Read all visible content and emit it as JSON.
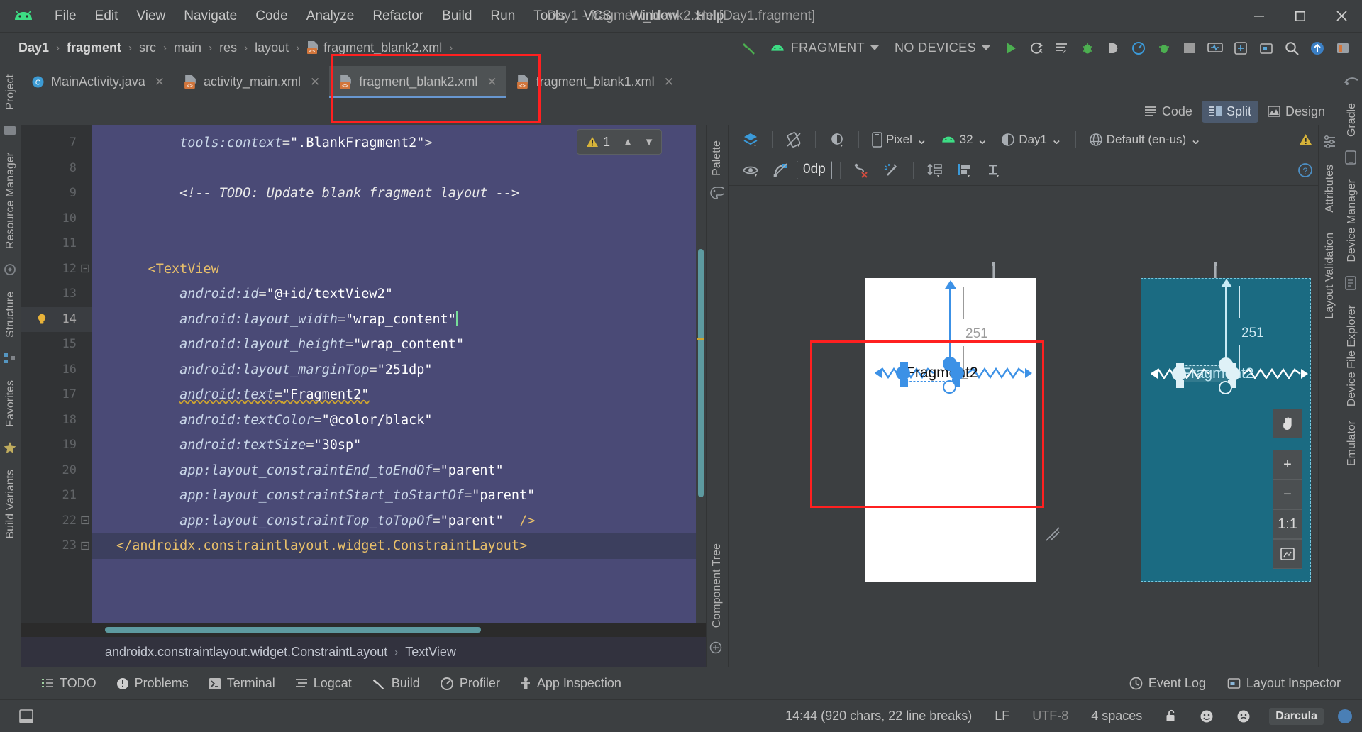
{
  "window": {
    "title": "Day1 - fragment_blank2.xml [Day1.fragment]",
    "minimize": "–",
    "maximize": "▢",
    "close": "✕"
  },
  "menubar": {
    "items": [
      {
        "label": "File",
        "mn": "F"
      },
      {
        "label": "Edit",
        "mn": "E"
      },
      {
        "label": "View",
        "mn": "V"
      },
      {
        "label": "Navigate",
        "mn": "N"
      },
      {
        "label": "Code",
        "mn": "C"
      },
      {
        "label": "Analyze",
        "mn": "z"
      },
      {
        "label": "Refactor",
        "mn": "R"
      },
      {
        "label": "Build",
        "mn": "B"
      },
      {
        "label": "Run",
        "mn": "u"
      },
      {
        "label": "Tools",
        "mn": "T"
      },
      {
        "label": "VCS",
        "mn": "S"
      },
      {
        "label": "Window",
        "mn": "W"
      },
      {
        "label": "Help",
        "mn": "H"
      }
    ]
  },
  "navbar": {
    "breadcrumbs": [
      "Day1",
      "fragment",
      "src",
      "main",
      "res",
      "layout",
      "fragment_blank2.xml"
    ],
    "separator": "›",
    "run_config": "FRAGMENT",
    "device": "NO DEVICES",
    "icons": [
      "build-hammer-icon",
      "android-icon",
      "run-icon",
      "run-with-coverage-icon",
      "apply-changes-icon",
      "debug-icon",
      "profile-icon",
      "attach-debugger-icon",
      "stop-icon",
      "avd-manager-icon",
      "sdk-manager-icon",
      "layout-inspector-icon",
      "search-icon",
      "update-icon",
      "project-structure-icon"
    ]
  },
  "left_strip": {
    "tabs": [
      "Project",
      "Resource Manager",
      "Structure",
      "Favorites",
      "Build Variants"
    ]
  },
  "right_strip": {
    "tabs": [
      "Gradle",
      "Device Manager",
      "Device File Explorer",
      "Emulator"
    ]
  },
  "editor_tabs": [
    {
      "label": "MainActivity.java",
      "icon": "java-class-icon",
      "active": false,
      "close": "✕"
    },
    {
      "label": "activity_main.xml",
      "icon": "xml-layout-icon",
      "active": false,
      "close": "✕"
    },
    {
      "label": "fragment_blank2.xml",
      "icon": "xml-layout-icon",
      "active": true,
      "close": "✕"
    },
    {
      "label": "fragment_blank1.xml",
      "icon": "xml-layout-icon",
      "active": false,
      "close": "✕"
    }
  ],
  "view_modes": [
    {
      "label": "Code",
      "icon": "code-lines-icon",
      "selected": false
    },
    {
      "label": "Split",
      "icon": "split-view-icon",
      "selected": true
    },
    {
      "label": "Design",
      "icon": "design-view-icon",
      "selected": false
    }
  ],
  "editor": {
    "first_line": 7,
    "current_line": 14,
    "lines": [
      {
        "n": 7,
        "segments": [
          {
            "t": "        ",
            "c": "punct"
          },
          {
            "t": "tools:context",
            "c": "attr"
          },
          {
            "t": "=",
            "c": "punct"
          },
          {
            "t": "\".BlankFragment2\"",
            "c": "str"
          },
          {
            "t": ">",
            "c": "punct"
          }
        ]
      },
      {
        "n": 8,
        "segments": []
      },
      {
        "n": 9,
        "segments": [
          {
            "t": "        ",
            "c": "punct"
          },
          {
            "t": "<!-- TODO: Update blank fragment layout -->",
            "c": "cmt"
          }
        ]
      },
      {
        "n": 10,
        "segments": []
      },
      {
        "n": 11,
        "segments": []
      },
      {
        "n": 12,
        "segments": [
          {
            "t": "    ",
            "c": "punct"
          },
          {
            "t": "<TextView",
            "c": "tag"
          }
        ]
      },
      {
        "n": 13,
        "segments": [
          {
            "t": "        ",
            "c": "punct"
          },
          {
            "t": "android:id",
            "c": "attr"
          },
          {
            "t": "=",
            "c": "punct"
          },
          {
            "t": "\"@+id/textView2\"",
            "c": "str"
          }
        ]
      },
      {
        "n": 14,
        "segments": [
          {
            "t": "        ",
            "c": "punct"
          },
          {
            "t": "android:layout_width",
            "c": "attr"
          },
          {
            "t": "=",
            "c": "punct"
          },
          {
            "t": "\"wrap_content\"",
            "c": "str"
          }
        ]
      },
      {
        "n": 15,
        "segments": [
          {
            "t": "        ",
            "c": "punct"
          },
          {
            "t": "android:layout_height",
            "c": "attr"
          },
          {
            "t": "=",
            "c": "punct"
          },
          {
            "t": "\"wrap_content\"",
            "c": "str"
          }
        ]
      },
      {
        "n": 16,
        "segments": [
          {
            "t": "        ",
            "c": "punct"
          },
          {
            "t": "android:layout_marginTop",
            "c": "attr"
          },
          {
            "t": "=",
            "c": "punct"
          },
          {
            "t": "\"251dp\"",
            "c": "str"
          }
        ]
      },
      {
        "n": 17,
        "segments": [
          {
            "t": "        ",
            "c": "punct"
          },
          {
            "t": "android:text",
            "c": "attr squig"
          },
          {
            "t": "=",
            "c": "punct squig"
          },
          {
            "t": "\"Fragment2\"",
            "c": "str squig"
          }
        ]
      },
      {
        "n": 18,
        "segments": [
          {
            "t": "        ",
            "c": "punct"
          },
          {
            "t": "android:textColor",
            "c": "attr"
          },
          {
            "t": "=",
            "c": "punct"
          },
          {
            "t": "\"@color/black\"",
            "c": "str"
          }
        ]
      },
      {
        "n": 19,
        "segments": [
          {
            "t": "        ",
            "c": "punct"
          },
          {
            "t": "android:textSize",
            "c": "attr"
          },
          {
            "t": "=",
            "c": "punct"
          },
          {
            "t": "\"30sp\"",
            "c": "str"
          }
        ]
      },
      {
        "n": 20,
        "segments": [
          {
            "t": "        ",
            "c": "punct"
          },
          {
            "t": "app:layout_constraintEnd_toEndOf",
            "c": "attr"
          },
          {
            "t": "=",
            "c": "punct"
          },
          {
            "t": "\"parent\"",
            "c": "str"
          }
        ]
      },
      {
        "n": 21,
        "segments": [
          {
            "t": "        ",
            "c": "punct"
          },
          {
            "t": "app:layout_constraintStart_toStartOf",
            "c": "attr"
          },
          {
            "t": "=",
            "c": "punct"
          },
          {
            "t": "\"parent\"",
            "c": "str"
          }
        ]
      },
      {
        "n": 22,
        "segments": [
          {
            "t": "        ",
            "c": "punct"
          },
          {
            "t": "app:layout_constraintTop_toTopOf",
            "c": "attr"
          },
          {
            "t": "=",
            "c": "punct"
          },
          {
            "t": "\"parent\"  ",
            "c": "str"
          },
          {
            "t": "/>",
            "c": "tag"
          }
        ]
      },
      {
        "n": 23,
        "segments": [
          {
            "t": "</androidx.constraintlayout.widget.ConstraintLayout>",
            "c": "tag"
          }
        ]
      }
    ],
    "inspection_count": "1",
    "inspection_up": "▲",
    "inspection_down": "▼",
    "bulb_line": 14,
    "breadcrumb": [
      "androidx.constraintlayout.widget.ConstraintLayout",
      "TextView"
    ],
    "breadcrumb_sep": "›"
  },
  "design": {
    "vertical_tabs_left": [
      "Palette",
      "Component Tree"
    ],
    "vertical_tabs_right": [
      "Attributes",
      "Layout Validation"
    ],
    "toolbar": {
      "design_surface": "design-surface-icon",
      "orientation": "orientation-icon",
      "theme_mode": "night-mode-icon",
      "device": "Pixel",
      "api": "32",
      "theme": "Day1",
      "locale": "Default (en-us)",
      "chevron": "⌄",
      "warning": "warning-icon",
      "help": "help-icon"
    },
    "toolbar2": {
      "visibility": "eye-icon",
      "autoconnect": "autoconnect-off-icon",
      "margin": "0dp",
      "clear_constraints": "clear-constraints-icon",
      "infer_constraints": "infer-constraints-icon",
      "pack": "pack-icon",
      "align": "align-icon",
      "guidelines": "guidelines-icon"
    },
    "preview": {
      "widget_text": "Fragment2",
      "margin_value": "251",
      "pan_icon": "pan-hand-icon",
      "zoom_in": "+",
      "zoom_out": "−",
      "zoom_fit_actual": "1:1",
      "zoom_fit_screen": "zoom-to-fit-icon"
    },
    "highlight_color": "#ff2020"
  },
  "toolwindows": {
    "items": [
      {
        "label": "TODO",
        "icon": "todo-icon"
      },
      {
        "label": "Problems",
        "icon": "problems-icon"
      },
      {
        "label": "Terminal",
        "icon": "terminal-icon"
      },
      {
        "label": "Logcat",
        "icon": "logcat-icon"
      },
      {
        "label": "Build",
        "icon": "build-icon"
      },
      {
        "label": "Profiler",
        "icon": "profiler-icon"
      },
      {
        "label": "App Inspection",
        "icon": "app-inspection-icon"
      }
    ],
    "right": [
      {
        "label": "Event Log",
        "icon": "event-log-icon"
      },
      {
        "label": "Layout Inspector",
        "icon": "layout-inspector-icon"
      }
    ]
  },
  "statusbar": {
    "caret_info": "14:44 (920 chars, 22 line breaks)",
    "line_separator": "LF",
    "encoding": "UTF-8",
    "indent": "4 spaces",
    "lock_icon": "unlocked-icon",
    "happy_icon": "☺",
    "sad_icon": "☹",
    "theme": "Darcula",
    "theme_dot": "#4a7fb5"
  }
}
